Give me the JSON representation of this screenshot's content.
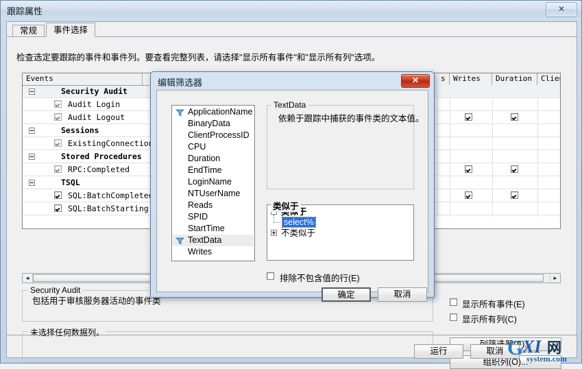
{
  "window": {
    "title": "跟踪属性",
    "close_glyph": "✕"
  },
  "tabs": [
    {
      "label": "常规",
      "active": false
    },
    {
      "label": "事件选择",
      "active": true
    }
  ],
  "description": "检查选定要跟踪的事件和事件列。要查看完整列表，请选择\"显示所有事件\"和\"显示所有列\"选项。",
  "grid": {
    "columns": [
      "Events",
      "s",
      "Writes",
      "Duration",
      "ClientProc"
    ],
    "rows": [
      {
        "type": "category",
        "label": "Security Audit",
        "expander": true,
        "checked": null,
        "cols": {}
      },
      {
        "type": "event",
        "label": "Audit Login",
        "expander": false,
        "checked": true,
        "dim": true,
        "cols": {
          "ClientProc": true
        }
      },
      {
        "type": "event",
        "label": "Audit Logout",
        "expander": false,
        "checked": true,
        "dim": true,
        "cols": {
          "Writes": true,
          "Duration": true,
          "ClientProc": true
        }
      },
      {
        "type": "category",
        "label": "Sessions",
        "expander": true,
        "checked": null,
        "cols": {}
      },
      {
        "type": "event",
        "label": "ExistingConnection",
        "expander": false,
        "checked": true,
        "dim": true,
        "cols": {
          "ClientProc": true
        }
      },
      {
        "type": "category",
        "label": "Stored Procedures",
        "expander": true,
        "checked": null,
        "cols": {}
      },
      {
        "type": "event",
        "label": "RPC:Completed",
        "expander": false,
        "checked": true,
        "dim": true,
        "cols": {
          "Writes": true,
          "Duration": true,
          "ClientProc": true
        }
      },
      {
        "type": "category",
        "label": "TSQL",
        "expander": true,
        "checked": null,
        "cols": {}
      },
      {
        "type": "event",
        "label": "SQL:BatchCompleted",
        "expander": false,
        "checked": true,
        "dim": false,
        "cols": {
          "Writes": true,
          "Duration": true,
          "ClientProc": true
        }
      },
      {
        "type": "event",
        "label": "SQL:BatchStarting",
        "expander": false,
        "checked": true,
        "dim": false,
        "cols": {
          "ClientProc": true
        }
      }
    ],
    "scrollbar": {
      "left_glyph": "◄",
      "right_glyph": "►"
    }
  },
  "info_group": {
    "caption": "Security Audit",
    "text": "包括用于审核服务器活动的事件类"
  },
  "column_group": {
    "caption": "未选择任何数据列。",
    "text": ""
  },
  "right_panel": {
    "show_all_events": {
      "label": "显示所有事件(E)",
      "checked": false
    },
    "show_all_columns": {
      "label": "显示所有列(C)",
      "checked": false
    },
    "column_filters_button": "列筛选器(F)...",
    "organize_columns_button": "组织列(O)..."
  },
  "footer": {
    "run_button": "运行",
    "cancel_button": "取消"
  },
  "dialog": {
    "title": "编辑筛选器",
    "close_glyph": "✕",
    "columns": [
      {
        "name": "ApplicationName",
        "filtered": true,
        "selected": false
      },
      {
        "name": "BinaryData",
        "filtered": false,
        "selected": false
      },
      {
        "name": "ClientProcessID",
        "filtered": false,
        "selected": false
      },
      {
        "name": "CPU",
        "filtered": false,
        "selected": false
      },
      {
        "name": "Duration",
        "filtered": false,
        "selected": false
      },
      {
        "name": "EndTime",
        "filtered": false,
        "selected": false
      },
      {
        "name": "LoginName",
        "filtered": false,
        "selected": false
      },
      {
        "name": "NTUserName",
        "filtered": false,
        "selected": false
      },
      {
        "name": "Reads",
        "filtered": false,
        "selected": false
      },
      {
        "name": "SPID",
        "filtered": false,
        "selected": false
      },
      {
        "name": "StartTime",
        "filtered": false,
        "selected": false
      },
      {
        "name": "TextData",
        "filtered": true,
        "selected": true
      },
      {
        "name": "Writes",
        "filtered": false,
        "selected": false
      }
    ],
    "detail_group": {
      "caption": "TextData",
      "text": "依赖于跟踪中捕获的事件类的文本值。"
    },
    "filter_tree": {
      "caption": "类似于",
      "like_node": "类似于",
      "like_value": "select%",
      "not_like_node": "不类似于"
    },
    "exclude_checkbox": {
      "label": "排除不包含值的行(E)",
      "checked": false
    },
    "ok_button": "确定",
    "cancel_button": "取消"
  },
  "watermark": {
    "brand": "GXI网",
    "domain": "system.com"
  },
  "colors": {
    "selection": "#2b6fd6",
    "dialog_close": "#cf3a1e",
    "window_border": "#6d8ab0"
  }
}
